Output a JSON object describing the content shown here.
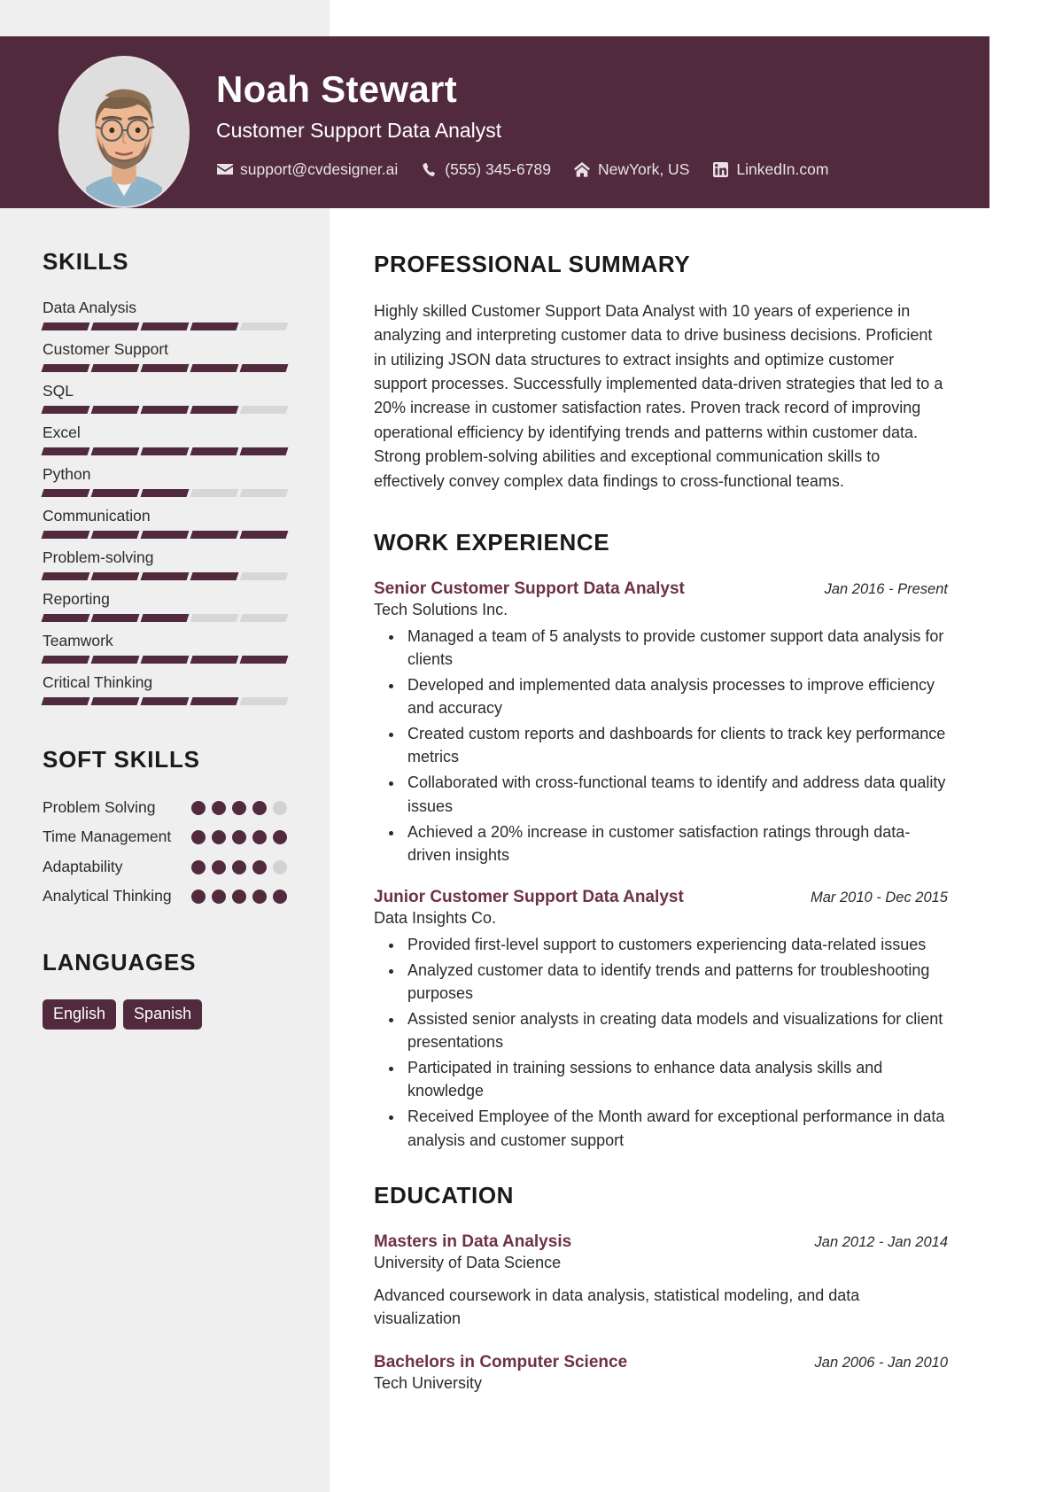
{
  "header": {
    "name": "Noah Stewart",
    "job_title": "Customer Support Data Analyst",
    "accent_color": "#512a3d",
    "contacts": [
      {
        "icon": "envelope-icon",
        "text": "support@cvdesigner.ai"
      },
      {
        "icon": "phone-icon",
        "text": "(555) 345-6789"
      },
      {
        "icon": "home-icon",
        "text": "NewYork, US"
      },
      {
        "icon": "linkedin-icon",
        "text": "LinkedIn.com"
      }
    ]
  },
  "sidebar": {
    "skills_heading": "SKILLS",
    "skills": [
      {
        "label": "Data Analysis",
        "filled": 4,
        "total": 5
      },
      {
        "label": "Customer Support",
        "filled": 5,
        "total": 5
      },
      {
        "label": "SQL",
        "filled": 4,
        "total": 5
      },
      {
        "label": "Excel",
        "filled": 5,
        "total": 5
      },
      {
        "label": "Python",
        "filled": 3,
        "total": 5
      },
      {
        "label": "Communication",
        "filled": 5,
        "total": 5
      },
      {
        "label": "Problem-solving",
        "filled": 4,
        "total": 5
      },
      {
        "label": "Reporting",
        "filled": 3,
        "total": 5
      },
      {
        "label": "Teamwork",
        "filled": 5,
        "total": 5
      },
      {
        "label": "Critical Thinking",
        "filled": 4,
        "total": 5
      }
    ],
    "soft_skills_heading": "SOFT SKILLS",
    "soft_skills": [
      {
        "label": "Problem Solving",
        "filled": 4,
        "total": 5
      },
      {
        "label": "Time Management",
        "filled": 5,
        "total": 5
      },
      {
        "label": "Adaptability",
        "filled": 4,
        "total": 5
      },
      {
        "label": "Analytical Thinking",
        "filled": 5,
        "total": 5
      }
    ],
    "languages_heading": "LANGUAGES",
    "languages": [
      "English",
      "Spanish"
    ]
  },
  "main": {
    "summary_heading": "PROFESSIONAL SUMMARY",
    "summary_text": "Highly skilled Customer Support Data Analyst with 10 years of experience in analyzing and interpreting customer data to drive business decisions. Proficient in utilizing JSON data structures to extract insights and optimize customer support processes. Successfully implemented data-driven strategies that led to a 20% increase in customer satisfaction rates. Proven track record of improving operational efficiency by identifying trends and patterns within customer data. Strong problem-solving abilities and exceptional communication skills to effectively convey complex data findings to cross-functional teams.",
    "work_heading": "WORK EXPERIENCE",
    "work": [
      {
        "title": "Senior Customer Support Data Analyst",
        "date": "Jan 2016 - Present",
        "org": "Tech Solutions Inc.",
        "bullets": [
          "Managed a team of 5 analysts to provide customer support data analysis for clients",
          "Developed and implemented data analysis processes to improve efficiency and accuracy",
          "Created custom reports and dashboards for clients to track key performance metrics",
          "Collaborated with cross-functional teams to identify and address data quality issues",
          "Achieved a 20% increase in customer satisfaction ratings through data-driven insights"
        ]
      },
      {
        "title": "Junior Customer Support Data Analyst",
        "date": "Mar 2010 - Dec 2015",
        "org": "Data Insights Co.",
        "bullets": [
          "Provided first-level support to customers experiencing data-related issues",
          "Analyzed customer data to identify trends and patterns for troubleshooting purposes",
          "Assisted senior analysts in creating data models and visualizations for client presentations",
          "Participated in training sessions to enhance data analysis skills and knowledge",
          "Received Employee of the Month award for exceptional performance in data analysis and customer support"
        ]
      }
    ],
    "education_heading": "EDUCATION",
    "education": [
      {
        "degree": "Masters in Data Analysis",
        "date": "Jan 2012 - Jan 2014",
        "school": "University of Data Science",
        "description": "Advanced coursework in data analysis, statistical modeling, and data visualization"
      },
      {
        "degree": "Bachelors in Computer Science",
        "date": "Jan 2006 - Jan 2010",
        "school": "Tech University",
        "description": ""
      }
    ]
  }
}
